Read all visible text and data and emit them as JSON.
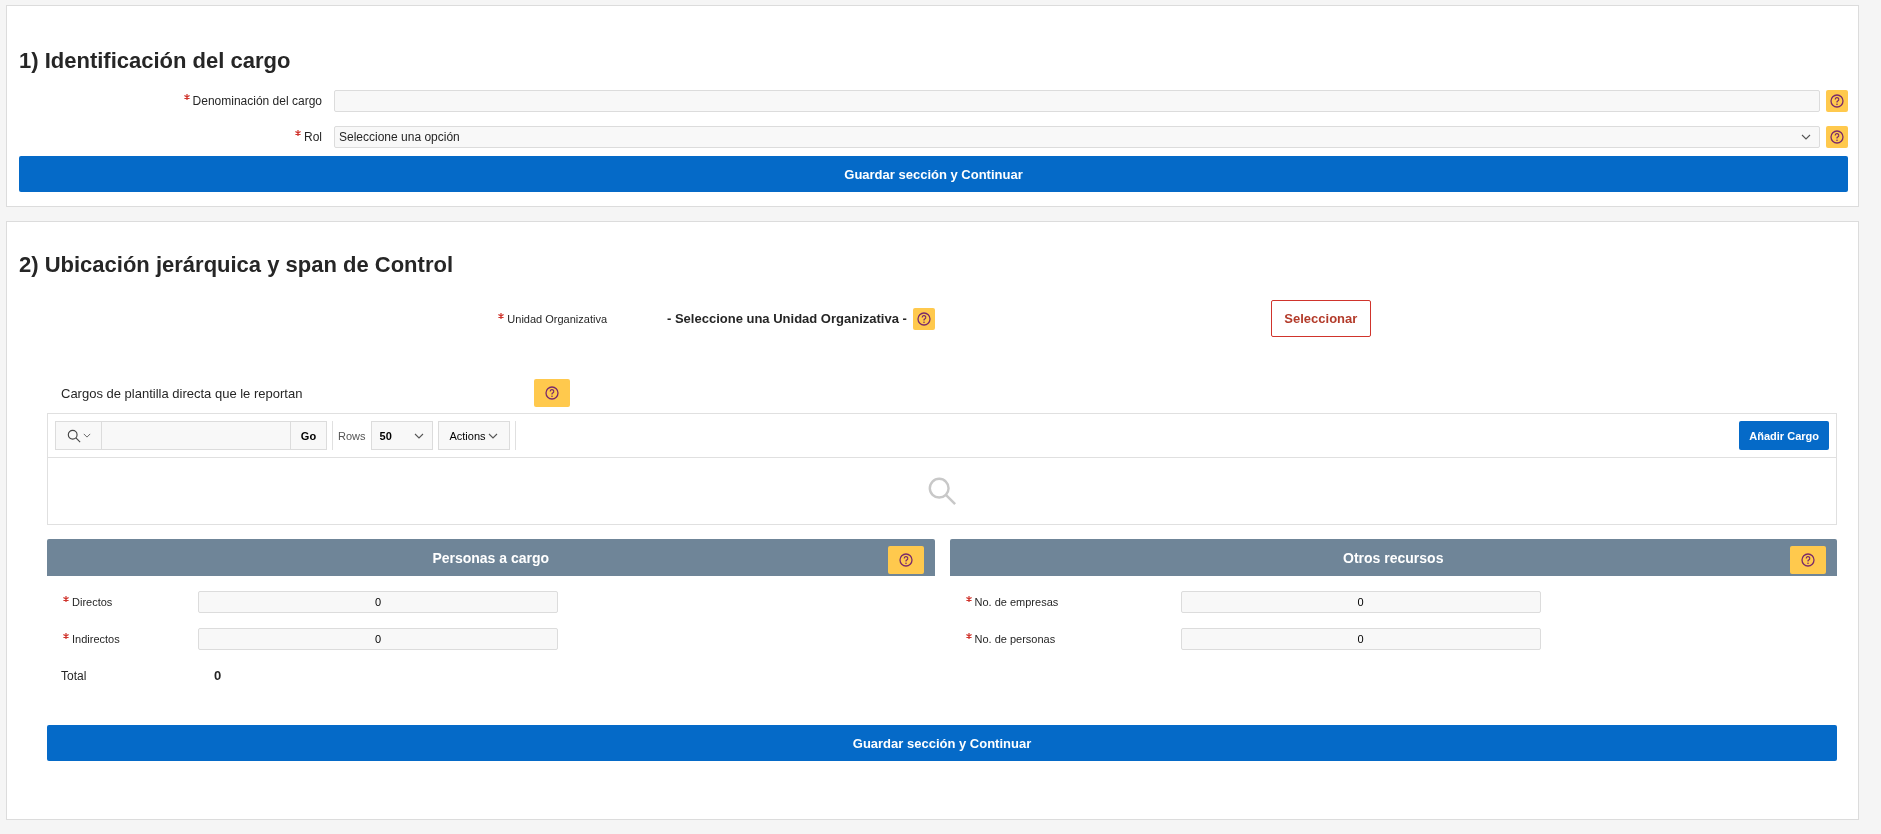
{
  "section_1": {
    "title": "1) Identificación del cargo",
    "fields": [
      {
        "kind": "text",
        "label": "Denominación del cargo",
        "required": true
      },
      {
        "kind": "select",
        "label": "Rol",
        "required": true,
        "value": "Seleccione una opción"
      }
    ],
    "button": "Guardar sección y Continuar"
  },
  "section_2": {
    "title": "2) Ubicación jerárquica y span de Control",
    "unidad": {
      "label": "Unidad Organizativa",
      "required": true,
      "value": "- Seleccione una Unidad Organizativa -",
      "button": "Seleccionar"
    },
    "report": {
      "label": "Cargos de plantilla directa que le reportan",
      "go": "Go",
      "rows_label": "Rows",
      "rows_value": "50",
      "actions": "Actions",
      "add_button": "Añadir Cargo"
    },
    "panels": [
      {
        "title": "Personas a cargo",
        "fields": [
          {
            "label": "Directos",
            "required": true,
            "value": "0"
          },
          {
            "label": "Indirectos",
            "required": true,
            "value": "0"
          }
        ],
        "total": {
          "label": "Total",
          "value": "0"
        }
      },
      {
        "title": "Otros recursos",
        "fields": [
          {
            "label": "No. de empresas",
            "required": true,
            "value": "0"
          },
          {
            "label": "No. de personas",
            "required": true,
            "value": "0"
          }
        ]
      }
    ],
    "button": "Guardar sección y Continuar"
  }
}
